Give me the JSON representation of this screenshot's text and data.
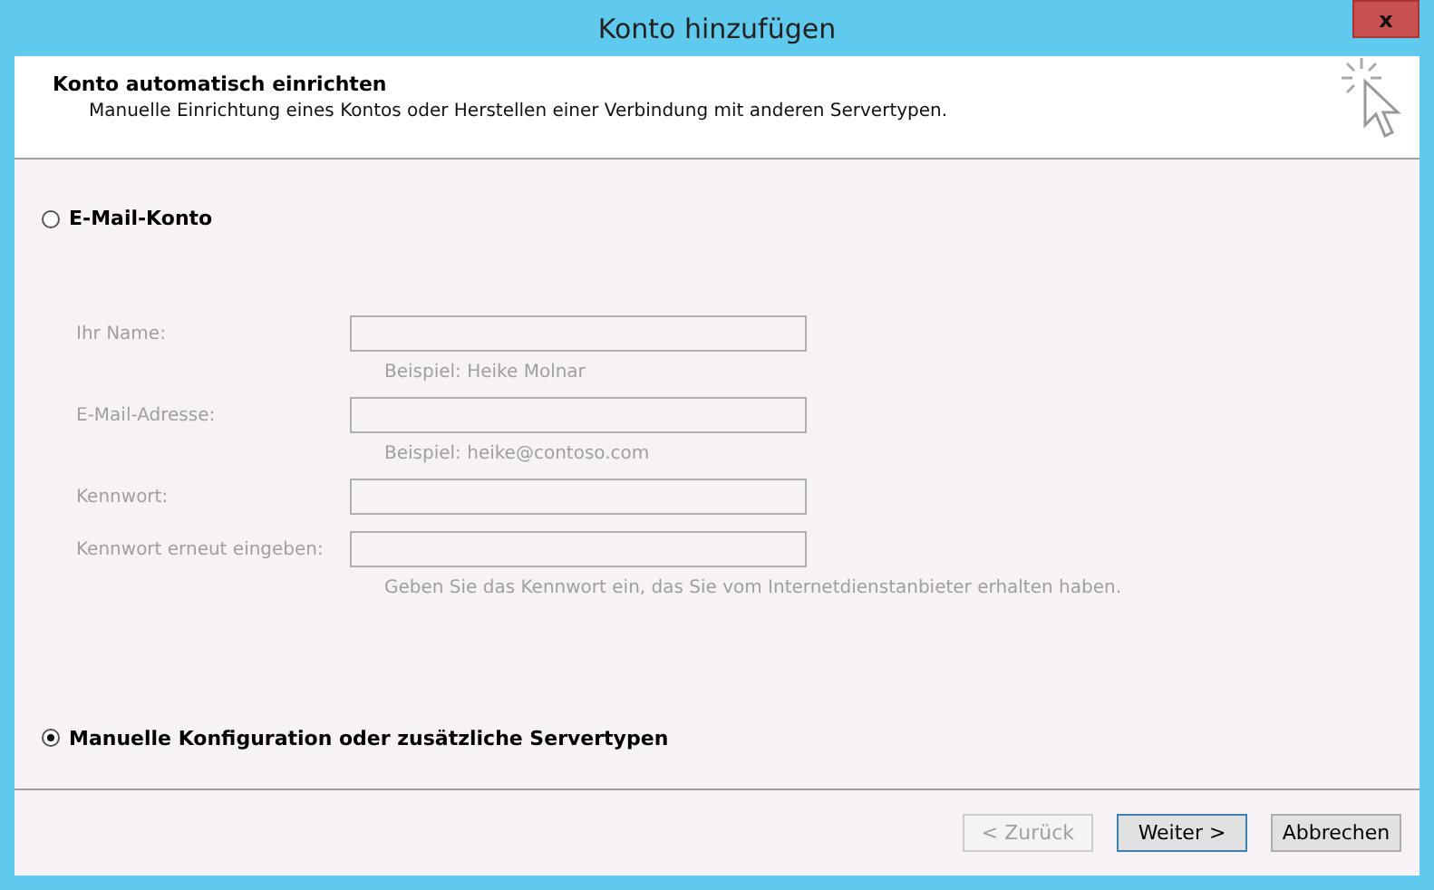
{
  "window": {
    "title": "Konto hinzufügen",
    "close": "x"
  },
  "header": {
    "title": "Konto automatisch einrichten",
    "subtitle": "Manuelle Einrichtung eines Kontos oder Herstellen einer Verbindung mit anderen Servertypen."
  },
  "options": [
    {
      "label": "E-Mail-Konto",
      "selected": false
    },
    {
      "label": "Manuelle Konfiguration oder zusätzliche Servertypen",
      "selected": true
    }
  ],
  "fields": [
    {
      "label": "Ihr Name:",
      "hint": "Beispiel: Heike Molnar",
      "disabled": true
    },
    {
      "label": "E-Mail-Adresse:",
      "hint": "Beispiel: heike@contoso.com",
      "disabled": true
    },
    {
      "label": "Kennwort:",
      "disabled": true
    },
    {
      "label": "Kennwort erneut eingeben:",
      "hint": "Geben Sie das Kennwort ein, das Sie vom Internetdienstanbieter erhalten haben.",
      "disabled": true
    }
  ],
  "buttons": [
    {
      "label": "< Zurück",
      "disabled": true,
      "default": false
    },
    {
      "label": "Weiter >",
      "disabled": false,
      "default": true
    },
    {
      "label": "Abbrechen",
      "disabled": false,
      "default": false
    }
  ]
}
